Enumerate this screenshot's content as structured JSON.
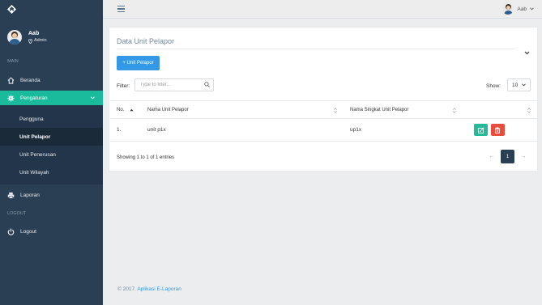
{
  "user": {
    "name": "Aab",
    "role": "Admin"
  },
  "sidebar": {
    "section_main": "MAIN",
    "section_logout": "LOGOUT",
    "items": {
      "beranda": "Beranda",
      "pengaturan": "Pengaturan",
      "laporan": "Laporan",
      "logout": "Logout"
    },
    "submenu": [
      "Pengguna",
      "Unit Pelapor",
      "Unit Penerusan",
      "Unit Wilayah"
    ],
    "active_submenu": "Unit Pelapor"
  },
  "topbar": {
    "user_name": "Aab"
  },
  "panel": {
    "title": "Data Unit Pelapor",
    "add_button": "+ Unit Pelapor",
    "filter_label": "Filter:",
    "filter_placeholder": "Type to filter...",
    "filter_value": "",
    "show_label": "Show:",
    "show_value": "10"
  },
  "table": {
    "headers": [
      "No.",
      "Nama Unit Pelapor",
      "Nama Singkat Unit Pelapor",
      ""
    ],
    "rows": [
      {
        "no": "1.",
        "nama": "unit p1x",
        "singkat": "up1x"
      }
    ]
  },
  "pagination": {
    "summary": "Showing 1 to 1 of 1 entries",
    "prev": "←",
    "current": "1",
    "next": "→"
  },
  "footer": {
    "text": "© 2017.",
    "link": "Aplikasi E-Laporan"
  },
  "colors": {
    "sidebar": "#2a3f54",
    "active": "#1abb9c",
    "primary": "#3399e6",
    "edit": "#26b99a",
    "delete": "#e74c3c"
  }
}
